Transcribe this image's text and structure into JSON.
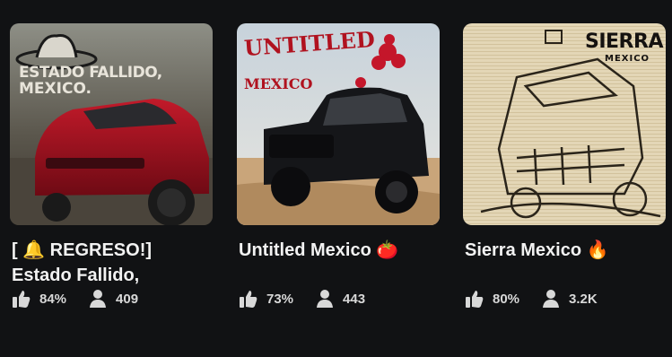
{
  "cards": [
    {
      "title": "[ 🔔 REGRESO!] Estado Fallido,",
      "thumbnail_text_1": "ESTADO FALLIDO,",
      "thumbnail_text_2": "MEXICO.",
      "like_ratio": "84%",
      "players": "409"
    },
    {
      "title": "Untitled Mexico 🍅",
      "thumbnail_text_1": "UNTITLED",
      "thumbnail_text_2": "MEXICO",
      "like_ratio": "73%",
      "players": "443"
    },
    {
      "title": "Sierra Mexico 🔥",
      "thumbnail_text_1": "SIERRA",
      "thumbnail_text_2": "MEXICO",
      "like_ratio": "80%",
      "players": "3.2K"
    }
  ],
  "icons": {
    "like": "thumbs-up-icon",
    "players": "person-icon"
  },
  "colors": {
    "background": "#111214",
    "text": "#f2f2f2",
    "stat_text": "#d8d8d8"
  }
}
